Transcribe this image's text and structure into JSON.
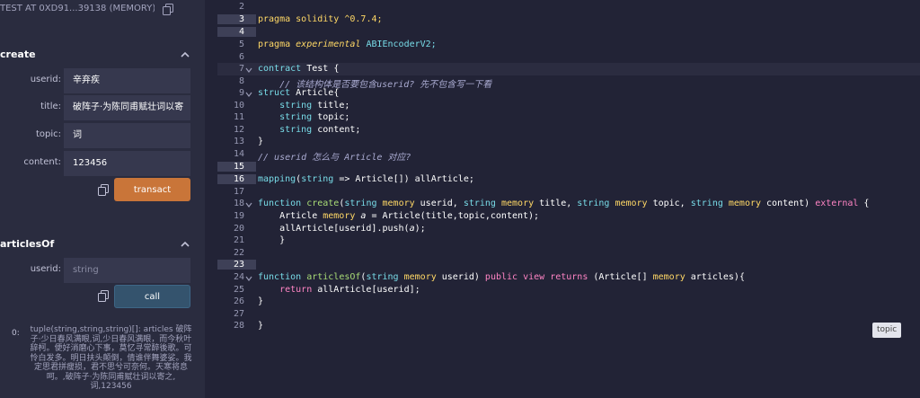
{
  "left": {
    "contract_title": "TEST AT 0XD91...39138 (MEMORY)",
    "create": {
      "title": "create",
      "fields": [
        {
          "label": "userid:",
          "value": "辛弃疾"
        },
        {
          "label": "title:",
          "value": "破阵子·为陈同甫赋壮词以寄"
        },
        {
          "label": "topic:",
          "value": "词"
        },
        {
          "label": "content:",
          "value": "123456"
        }
      ],
      "button": "transact"
    },
    "articlesOf": {
      "title": "articlesOf",
      "field": {
        "label": "userid:",
        "placeholder": "string"
      },
      "button": "call"
    },
    "result": {
      "index": "0:",
      "text": "tuple(string,string,string)[]: articles 破阵子·少日春风满眼,词,少日春风满眼，而今秋叶辞柯。便好消磨心下事，莫忆寻常醉後歌。可怜白发多。明日扶头颠倒，倩谁伴舞婆娑。我定思君拼瘦损，君不思兮可奈何。天寒将息呵。,破阵子·为陈同甫赋壮词以寄之,词,123456"
    }
  },
  "editor": {
    "lines": [
      {
        "n": "2"
      },
      {
        "n": "3"
      },
      {
        "n": "4"
      },
      {
        "n": "5"
      },
      {
        "n": "6"
      },
      {
        "n": "7"
      },
      {
        "n": "8"
      },
      {
        "n": "9"
      },
      {
        "n": "10"
      },
      {
        "n": "11"
      },
      {
        "n": "12"
      },
      {
        "n": "13"
      },
      {
        "n": "14"
      },
      {
        "n": "15"
      },
      {
        "n": "16"
      },
      {
        "n": "17"
      },
      {
        "n": "18"
      },
      {
        "n": "19"
      },
      {
        "n": "20"
      },
      {
        "n": "21"
      },
      {
        "n": "22"
      },
      {
        "n": "23"
      },
      {
        "n": "24"
      },
      {
        "n": "25"
      },
      {
        "n": "26"
      },
      {
        "n": "27"
      },
      {
        "n": "28"
      }
    ],
    "code": {
      "l3_a": "pragma",
      "l3_b": "solidity",
      "l3_c": "^0.7.4;",
      "l5_a": "pragma",
      "l5_b": "experimental",
      "l5_c": "ABIEncoderV2;",
      "l7_a": "contract",
      "l7_b": "Test",
      "l7_c": "{",
      "l8": "    // 该结构体是否要包含userid? 先不包含写一下看",
      "l9_a": "struct",
      "l9_b": "Article",
      "l9_c": "{",
      "l10_a": "    string",
      "l10_b": " title;",
      "l11_a": "    string",
      "l11_b": " topic;",
      "l12_a": "    string",
      "l12_b": " content;",
      "l13": "}",
      "l14": "// userid 怎么与 Article 对应?",
      "l16_a": "mapping",
      "l16_b": "(",
      "l16_c": "string",
      "l16_d": " => ",
      "l16_e": "Article",
      "l16_f": "[]) allArticle;",
      "l18_a": "function",
      "l18_b": "create",
      "l18_c": "(",
      "l18_d": "string",
      "l18_e": "memory",
      "l18_f": " userid, ",
      "l18_g": "string",
      "l18_h": "memory",
      "l18_i": " title, ",
      "l18_j": "string",
      "l18_k": "memory",
      "l18_l": " topic, ",
      "l18_m": "string",
      "l18_n": "memory",
      "l18_o": " content) ",
      "l18_p": "external",
      "l18_q": " {",
      "l19_a": "    Article ",
      "l19_b": "memory",
      "l19_c": " a",
      "l19_d": " = Article(title,topic,content);",
      "l20_a": "    allArticle[userid].push(",
      "l20_b": "a",
      "l20_c": ");",
      "l21": "    }",
      "l24_a": "function",
      "l24_b": "articlesOf",
      "l24_c": "(",
      "l24_d": "string",
      "l24_e": "memory",
      "l24_f": " userid) ",
      "l24_g": "public",
      "l24_h": "view",
      "l24_i": "returns",
      "l24_j": " (Article[] ",
      "l24_k": "memory",
      "l24_l": " articles){",
      "l25_a": "    ",
      "l25_b": "return",
      "l25_c": " allArticle[userid];",
      "l26": "}",
      "l28": "}"
    }
  },
  "tooltip": "topic",
  "icons": {
    "copy": "copy-icon",
    "chevron": "chevron-up-icon",
    "fold": "fold-arrow-icon"
  },
  "colors": {
    "transact": "#c97539",
    "call": "#34536d",
    "keyword": "#ffd866",
    "type": "#78dce8"
  }
}
